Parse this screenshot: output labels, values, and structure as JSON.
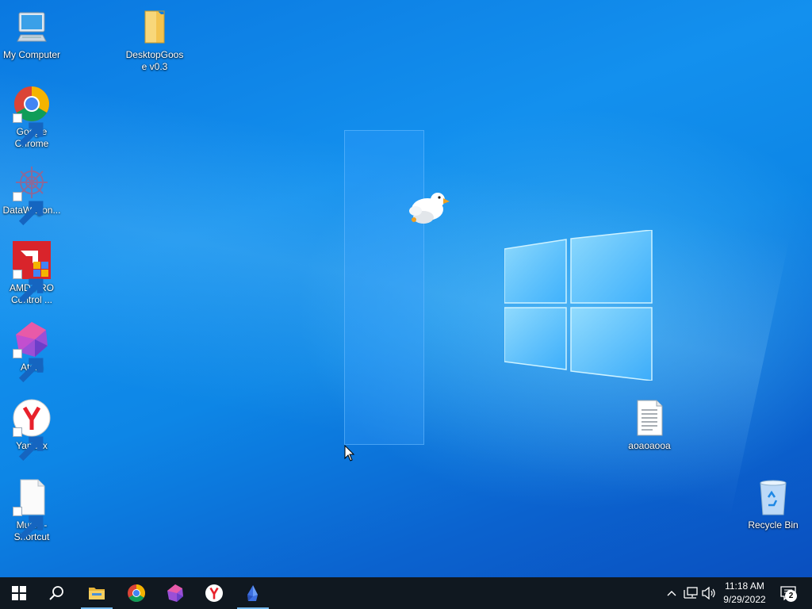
{
  "desktop": {
    "icons": [
      {
        "label": "My Computer",
        "icon": "monitor-icon"
      },
      {
        "label": "DesktopGoos e v0.3",
        "icon": "folder-icon"
      },
      {
        "label": "Google Chrome",
        "icon": "chrome-icon"
      },
      {
        "label": "DataWagon...",
        "icon": "datawagon-icon"
      },
      {
        "label": "AMD PRO Control ...",
        "icon": "amd-icon"
      },
      {
        "label": "Atom",
        "icon": "atom-icon"
      },
      {
        "label": "Yandex",
        "icon": "yandex-icon"
      },
      {
        "label": "Music - Shortcut",
        "icon": "file-icon"
      },
      {
        "label": "aoaoaooa",
        "icon": "text-file-icon"
      },
      {
        "label": "Recycle Bin",
        "icon": "recycle-bin-icon"
      }
    ]
  },
  "taskbar": {
    "pinned": [
      {
        "name": "start",
        "icon": "windows-start-icon"
      },
      {
        "name": "search",
        "icon": "search-icon"
      },
      {
        "name": "file-explorer",
        "icon": "folder-icon"
      },
      {
        "name": "chrome",
        "icon": "chrome-icon"
      },
      {
        "name": "atom",
        "icon": "atom-icon"
      },
      {
        "name": "yandex",
        "icon": "yandex-icon"
      },
      {
        "name": "goose",
        "icon": "goose-icon"
      }
    ],
    "clock": {
      "time": "11:18 AM",
      "date": "9/29/2022"
    },
    "notifications": {
      "count": "2"
    }
  },
  "colors": {
    "accent": "#76b9ed",
    "taskbar": "#101820",
    "desktop": "#0a78e0"
  }
}
